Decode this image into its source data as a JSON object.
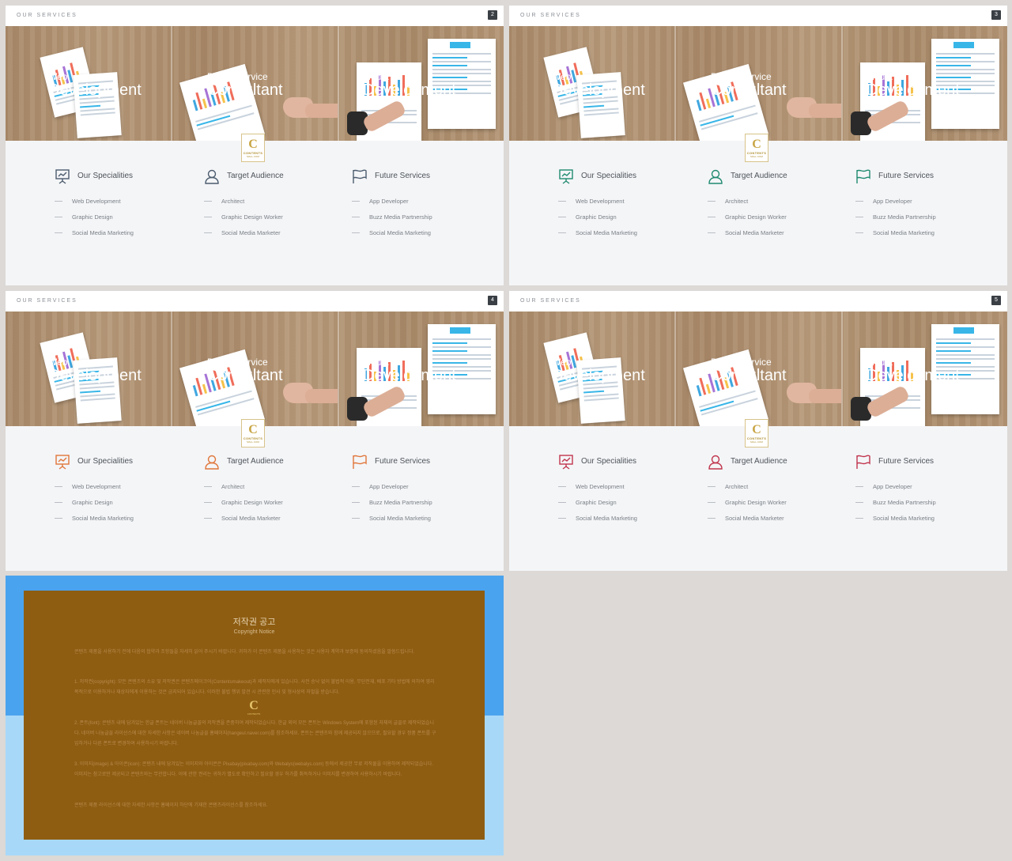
{
  "slides": [
    {
      "section_label": "OUR SERVICES",
      "page": "2",
      "accent": "#4b5b6e",
      "panels": [
        {
          "line1": "Web",
          "line2": "Development"
        },
        {
          "line1": "Digital Service",
          "line2": "Consultant"
        },
        {
          "line1": "Media",
          "line2": "Development"
        }
      ],
      "logo": {
        "letter": "C",
        "name": "CONTENTS",
        "tag": "MALL.COM"
      },
      "columns": [
        {
          "icon": "presentation-chart-icon",
          "title": "Our Specialities",
          "items": [
            "Web Development",
            "Graphic Design",
            "Social Media Marketing"
          ]
        },
        {
          "icon": "user-icon",
          "title": "Target Audience",
          "items": [
            "Architect",
            "Graphic Design Worker",
            "Social Media Marketer"
          ]
        },
        {
          "icon": "flag-icon",
          "title": "Future Services",
          "items": [
            "App Developer",
            "Buzz Media Partnership",
            "Social Media Marketing"
          ]
        }
      ]
    },
    {
      "section_label": "OUR SERVICES",
      "page": "3",
      "accent": "#1f8a70",
      "panels": [
        {
          "line1": "Web",
          "line2": "Development"
        },
        {
          "line1": "Digital Service",
          "line2": "Consultant"
        },
        {
          "line1": "Media",
          "line2": "Development"
        }
      ],
      "logo": {
        "letter": "C",
        "name": "CONTENTS",
        "tag": "MALL.COM"
      },
      "columns": [
        {
          "icon": "presentation-chart-icon",
          "title": "Our Specialities",
          "items": [
            "Web Development",
            "Graphic Design",
            "Social Media Marketing"
          ]
        },
        {
          "icon": "user-icon",
          "title": "Target Audience",
          "items": [
            "Architect",
            "Graphic Design Worker",
            "Social Media Marketer"
          ]
        },
        {
          "icon": "flag-icon",
          "title": "Future Services",
          "items": [
            "App Developer",
            "Buzz Media Partnership",
            "Social Media Marketing"
          ]
        }
      ]
    },
    {
      "section_label": "OUR SERVICES",
      "page": "4",
      "accent": "#e0763a",
      "panels": [
        {
          "line1": "Web",
          "line2": "Development"
        },
        {
          "line1": "Digital Service",
          "line2": "Consultant"
        },
        {
          "line1": "Media",
          "line2": "Development"
        }
      ],
      "logo": {
        "letter": "C",
        "name": "CONTENTS",
        "tag": "MALL.COM"
      },
      "columns": [
        {
          "icon": "presentation-chart-icon",
          "title": "Our Specialities",
          "items": [
            "Web Development",
            "Graphic Design",
            "Social Media Marketing"
          ]
        },
        {
          "icon": "user-icon",
          "title": "Target Audience",
          "items": [
            "Architect",
            "Graphic Design Worker",
            "Social Media Marketer"
          ]
        },
        {
          "icon": "flag-icon",
          "title": "Future Services",
          "items": [
            "App Developer",
            "Buzz Media Partnership",
            "Social Media Marketing"
          ]
        }
      ]
    },
    {
      "section_label": "OUR SERVICES",
      "page": "5",
      "accent": "#c0344d",
      "panels": [
        {
          "line1": "Web",
          "line2": "Development"
        },
        {
          "line1": "Digital Service",
          "line2": "Consultant"
        },
        {
          "line1": "Media",
          "line2": "Development"
        }
      ],
      "logo": {
        "letter": "C",
        "name": "CONTENTS",
        "tag": "MALL.COM"
      },
      "columns": [
        {
          "icon": "presentation-chart-icon",
          "title": "Our Specialities",
          "items": [
            "Web Development",
            "Graphic Design",
            "Social Media Marketing"
          ]
        },
        {
          "icon": "user-icon",
          "title": "Target Audience",
          "items": [
            "Architect",
            "Graphic Design Worker",
            "Social Media Marketer"
          ]
        },
        {
          "icon": "flag-icon",
          "title": "Future Services",
          "items": [
            "App Developer",
            "Buzz Media Partnership",
            "Social Media Marketing"
          ]
        }
      ]
    }
  ],
  "copyright": {
    "title": "저작권 공고",
    "subtitle": "Copyright Notice",
    "logo_letter": "C",
    "logo_name": "CONTENTS",
    "paragraphs": [
      "콘텐츠 제품을 사용하기 전에 다음의 협약과 조항들을 자세히 읽어 주시기 바랍니다. 귀하가 이 콘텐츠 제품을 사용하는 것은 사용자 계약과 보증에 동의하셨음을 말씀드립니다.",
      "1. 저작권(copyright): 모든 콘텐츠의 소유 및 저작권은 콘텐츠메이크어(Contentsmakeout)과 제작자에게 있습니다. 사전 승낙 없이 불법적 이용, 무단전재, 배포 기타 방법에 의하여 영리 목적으로 이용하거나 재상자에게 이용하는 것은 금지되어 있습니다. 이러한 불법 행위 발견 시 관련한 민사 및 형사상의 처벌을 받습니다.",
      "2. 폰트(font): 콘텐츠 내에 담겨있는 한글 폰트는 네이버 나눔글꼴의 저작권을 존중하여 제작되었습니다. 한글 외의 모든 폰트는 Windows System에 포함된 자체의 글꼴로 제작되었습니다. 네이버 나눔글꼴 라이선스에 대한 자세한 사항은 네이버 나눔글꼴 홈페이지(hangeul.naver.com)를 참조하세요. 폰트는 콘텐츠와 함께 제공되지 않으므로, 필요할 경우 정품 폰트를 구입하거나 다른 폰트로 변경하여 사용하시기 바랍니다.",
      "3. 이미지(image) & 아이콘(icon): 콘텐츠 내에 담겨있는 이미지와 아이콘은 Pixabay(pixabay.com)와 Webalys(webalys.com) 등에서 제공한 무료 저작물을 이용하여 제작되었습니다. 이미지는 참고로만 제공되고 콘텐츠와는 무관합니다. 이에 관한 권리는 귀하가 별도로 확인하고 필요할 경우 허가를 취득하거나 이미지를 변경하여 사용하시기 바랍니다.",
      "콘텐츠 제품 라이선스에 대한 자세한 사항은 홈페이지 하단에 기재한 콘텐츠라이선스를 참조하세요."
    ]
  }
}
